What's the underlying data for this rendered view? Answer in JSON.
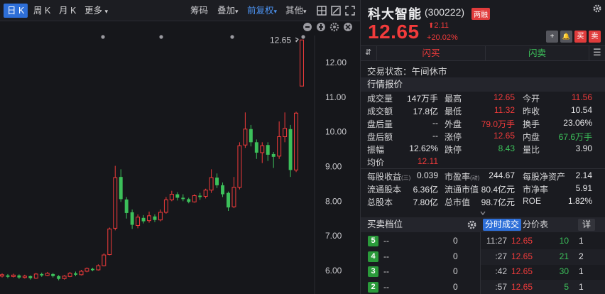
{
  "colors": {
    "up": "#f23b3b",
    "down": "#3cc05a",
    "accent": "#2e6fd8"
  },
  "toolbar": {
    "periods": [
      "日 K",
      "周 K",
      "月 K",
      "更多"
    ],
    "more_arrow": "▾",
    "chips_label": "筹码",
    "overlay_label": "叠加",
    "adjust_label": "前复权",
    "other_label": "其他",
    "dropdown_arrow": "▾"
  },
  "chart_data": {
    "type": "candlestick",
    "y_ticks": [
      "12.00",
      "11.00",
      "10.00",
      "9.00",
      "8.00",
      "7.00",
      "6.00"
    ],
    "last_price_marker": "12.65",
    "ylim": [
      5.7,
      13.2
    ],
    "candles": [
      {
        "o": 5.84,
        "c": 5.88,
        "h": 5.92,
        "l": 5.8
      },
      {
        "o": 5.86,
        "c": 5.82,
        "h": 5.9,
        "l": 5.78
      },
      {
        "o": 5.83,
        "c": 5.87,
        "h": 5.91,
        "l": 5.8
      },
      {
        "o": 5.86,
        "c": 5.8,
        "h": 5.89,
        "l": 5.76
      },
      {
        "o": 5.8,
        "c": 5.84,
        "h": 5.88,
        "l": 5.77
      },
      {
        "o": 5.84,
        "c": 5.78,
        "h": 5.86,
        "l": 5.74
      },
      {
        "o": 5.78,
        "c": 5.9,
        "h": 5.93,
        "l": 5.76
      },
      {
        "o": 5.9,
        "c": 5.86,
        "h": 5.94,
        "l": 5.82
      },
      {
        "o": 5.86,
        "c": 5.92,
        "h": 5.96,
        "l": 5.84
      },
      {
        "o": 5.9,
        "c": 5.84,
        "h": 5.93,
        "l": 5.8
      },
      {
        "o": 5.84,
        "c": 5.76,
        "h": 5.87,
        "l": 5.72
      },
      {
        "o": 5.77,
        "c": 5.84,
        "h": 5.87,
        "l": 5.74
      },
      {
        "o": 5.83,
        "c": 5.92,
        "h": 5.96,
        "l": 5.81
      },
      {
        "o": 5.92,
        "c": 5.88,
        "h": 5.97,
        "l": 5.84
      },
      {
        "o": 5.88,
        "c": 5.98,
        "h": 6.02,
        "l": 5.86
      },
      {
        "o": 5.98,
        "c": 6.06,
        "h": 6.09,
        "l": 5.95
      },
      {
        "o": 6.05,
        "c": 6.01,
        "h": 6.08,
        "l": 5.98
      },
      {
        "o": 6.02,
        "c": 6.14,
        "h": 6.18,
        "l": 6.0
      },
      {
        "o": 6.14,
        "c": 6.45,
        "h": 6.5,
        "l": 6.12
      },
      {
        "o": 6.46,
        "c": 7.2,
        "h": 7.24,
        "l": 6.44
      },
      {
        "o": 7.22,
        "c": 8.68,
        "h": 9.02,
        "l": 7.16
      },
      {
        "o": 8.7,
        "c": 8.06,
        "h": 8.92,
        "l": 7.98
      },
      {
        "o": 8.05,
        "c": 7.66,
        "h": 8.12,
        "l": 7.5
      },
      {
        "o": 7.68,
        "c": 7.32,
        "h": 7.76,
        "l": 7.2
      },
      {
        "o": 7.3,
        "c": 7.54,
        "h": 7.62,
        "l": 7.22
      },
      {
        "o": 7.52,
        "c": 7.42,
        "h": 7.6,
        "l": 7.36
      },
      {
        "o": 7.44,
        "c": 7.58,
        "h": 7.7,
        "l": 7.38
      },
      {
        "o": 7.56,
        "c": 7.46,
        "h": 7.62,
        "l": 7.4
      },
      {
        "o": 7.46,
        "c": 7.68,
        "h": 7.76,
        "l": 7.42
      },
      {
        "o": 7.68,
        "c": 8.04,
        "h": 8.12,
        "l": 7.64
      },
      {
        "o": 8.04,
        "c": 8.2,
        "h": 8.3,
        "l": 8.0
      },
      {
        "o": 8.2,
        "c": 8.1,
        "h": 8.26,
        "l": 8.02
      },
      {
        "o": 8.1,
        "c": 8.06,
        "h": 8.2,
        "l": 8.0
      },
      {
        "o": 8.06,
        "c": 7.98,
        "h": 8.1,
        "l": 7.94
      },
      {
        "o": 7.98,
        "c": 8.16,
        "h": 8.2,
        "l": 7.96
      },
      {
        "o": 8.16,
        "c": 8.12,
        "h": 8.24,
        "l": 8.04
      },
      {
        "o": 8.14,
        "c": 8.32,
        "h": 8.36,
        "l": 8.08
      },
      {
        "o": 8.32,
        "c": 8.68,
        "h": 8.92,
        "l": 8.24
      },
      {
        "o": 8.68,
        "c": 8.46,
        "h": 8.8,
        "l": 8.38
      },
      {
        "o": 8.46,
        "c": 8.2,
        "h": 8.54,
        "l": 8.12
      },
      {
        "o": 8.24,
        "c": 7.82,
        "h": 8.28,
        "l": 7.72
      },
      {
        "o": 7.84,
        "c": 8.4,
        "h": 8.7,
        "l": 7.8
      },
      {
        "o": 8.4,
        "c": 9.6,
        "h": 9.7,
        "l": 8.34
      },
      {
        "o": 9.62,
        "c": 10.08,
        "h": 10.56,
        "l": 9.54
      },
      {
        "o": 10.08,
        "c": 9.7,
        "h": 10.2,
        "l": 9.58
      },
      {
        "o": 9.7,
        "c": 9.4,
        "h": 9.78,
        "l": 9.22
      },
      {
        "o": 9.4,
        "c": 9.6,
        "h": 9.7,
        "l": 9.1
      },
      {
        "o": 9.62,
        "c": 9.34,
        "h": 9.7,
        "l": 9.16
      },
      {
        "o": 9.36,
        "c": 9.28,
        "h": 9.42,
        "l": 8.96
      },
      {
        "o": 9.3,
        "c": 9.86,
        "h": 10.3,
        "l": 9.22
      },
      {
        "o": 9.86,
        "c": 10.1,
        "h": 10.56,
        "l": 9.7
      },
      {
        "o": 10.08,
        "c": 8.9,
        "h": 10.2,
        "l": 8.7
      },
      {
        "o": 8.9,
        "c": 10.54,
        "h": 10.58,
        "l": 8.84
      },
      {
        "o": 11.32,
        "c": 12.65,
        "h": 12.65,
        "l": 11.32
      }
    ]
  },
  "stock": {
    "name": "科大智能",
    "code": "(300222)",
    "badge": "两融",
    "price": "12.65",
    "change": "2.11",
    "change_arrow": "⬆",
    "change_pct": "+20.02%"
  },
  "header_buttons": {
    "add": "+",
    "alert": "🔔",
    "buy": "买",
    "sell": "卖",
    "menu": "☰"
  },
  "flash": {
    "buy": "闪买",
    "sell": "闪卖",
    "toggle": "⇵"
  },
  "status": {
    "text": "交易状态：午间休市"
  },
  "quote_title": "行情报价",
  "quote_rows": [
    [
      {
        "l": "成交量",
        "v": "147万手",
        "c": "white"
      },
      {
        "l": "最高",
        "v": "12.65",
        "c": "red"
      },
      {
        "l": "今开",
        "v": "11.56",
        "c": "red"
      }
    ],
    [
      {
        "l": "成交额",
        "v": "17.8亿",
        "c": "white"
      },
      {
        "l": "最低",
        "v": "11.32",
        "c": "red"
      },
      {
        "l": "昨收",
        "v": "10.54",
        "c": "white"
      }
    ],
    [
      {
        "l": "盘后量",
        "v": "--",
        "c": "white"
      },
      {
        "l": "外盘",
        "v": "79.0万手",
        "c": "red"
      },
      {
        "l": "换手",
        "v": "23.06%",
        "c": "white"
      }
    ],
    [
      {
        "l": "盘后额",
        "v": "--",
        "c": "white"
      },
      {
        "l": "涨停",
        "v": "12.65",
        "c": "red"
      },
      {
        "l": "内盘",
        "v": "67.6万手",
        "c": "green"
      }
    ],
    [
      {
        "l": "振幅",
        "v": "12.62%",
        "c": "white"
      },
      {
        "l": "跌停",
        "v": "8.43",
        "c": "green"
      },
      {
        "l": "量比",
        "v": "3.90",
        "c": "white"
      }
    ],
    [
      {
        "l": "均价",
        "v": "12.11",
        "c": "red"
      }
    ]
  ],
  "fund_rows": [
    [
      {
        "l": "每股收益",
        "s": "(三)",
        "v": "0.039"
      },
      {
        "l": "市盈率",
        "s": "(动)",
        "v": "244.67"
      },
      {
        "l": "每股净资产",
        "s": "",
        "v": "2.14"
      }
    ],
    [
      {
        "l": "流通股本",
        "s": "",
        "v": "6.36亿"
      },
      {
        "l": "流通市值",
        "s": "",
        "v": "80.4亿元"
      },
      {
        "l": "市净率",
        "s": "",
        "v": "5.91"
      }
    ],
    [
      {
        "l": "总股本",
        "s": "",
        "v": "7.80亿"
      },
      {
        "l": "总市值",
        "s": "",
        "v": "98.7亿元"
      },
      {
        "l": "ROE",
        "s": "",
        "v": "1.82%"
      }
    ]
  ],
  "orderbook": {
    "title": "买卖档位",
    "rows": [
      {
        "n": "5",
        "p": "--",
        "v": "0"
      },
      {
        "n": "4",
        "p": "--",
        "v": "0"
      },
      {
        "n": "3",
        "p": "--",
        "v": "0"
      },
      {
        "n": "2",
        "p": "--",
        "v": "0"
      }
    ]
  },
  "ticks_tabs": {
    "ticks": "分时成交",
    "price_table": "分价表",
    "detail": "详"
  },
  "ticks": [
    {
      "t": "11:27",
      "p": "12.65",
      "v": "10",
      "n": "1"
    },
    {
      "t": ":27",
      "p": "12.65",
      "v": "21",
      "n": "2"
    },
    {
      "t": ":42",
      "p": "12.65",
      "v": "30",
      "n": "1"
    },
    {
      "t": ":57",
      "p": "12.65",
      "v": "5",
      "n": "1"
    }
  ]
}
